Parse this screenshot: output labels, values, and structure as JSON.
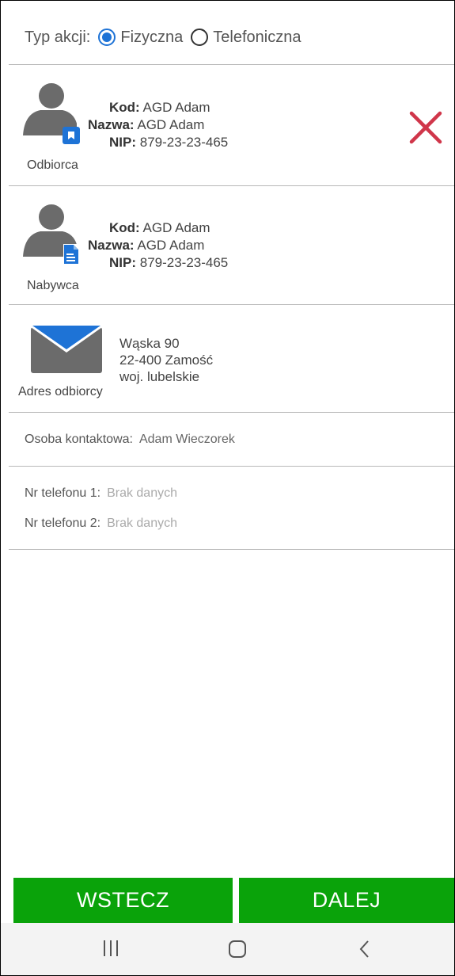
{
  "action_type": {
    "label": "Typ akcji:",
    "options": [
      {
        "label": "Fizyczna",
        "selected": true
      },
      {
        "label": "Telefoniczna",
        "selected": false
      }
    ]
  },
  "recipient": {
    "caption": "Odbiorca",
    "kod_label": "Kod:",
    "kod": "AGD Adam",
    "nazwa_label": "Nazwa:",
    "nazwa": "AGD Adam",
    "nip_label": "NIP:",
    "nip": "879-23-23-465"
  },
  "buyer": {
    "caption": "Nabywca",
    "kod_label": "Kod:",
    "kod": "AGD Adam",
    "nazwa_label": "Nazwa:",
    "nazwa": "AGD Adam",
    "nip_label": "NIP:",
    "nip": "879-23-23-465"
  },
  "address": {
    "caption": "Adres odbiorcy",
    "line1": "Wąska 90",
    "line2": "22-400 Zamość",
    "line3": "woj. lubelskie"
  },
  "contact": {
    "label": "Osoba kontaktowa:",
    "value": "Adam Wieczorek"
  },
  "phones": {
    "phone1_label": "Nr telefonu 1:",
    "phone1_value": "Brak danych",
    "phone2_label": "Nr telefonu 2:",
    "phone2_value": "Brak danych"
  },
  "buttons": {
    "back": "WSTECZ",
    "next": "DALEJ"
  },
  "colors": {
    "accent": "#1e73d6",
    "button": "#0aa30a",
    "delete": "#d0364a"
  },
  "icons": [
    "person-icon",
    "bookmark-badge-icon",
    "document-badge-icon",
    "envelope-icon",
    "close-icon",
    "recent-apps-icon",
    "home-icon",
    "back-icon"
  ]
}
